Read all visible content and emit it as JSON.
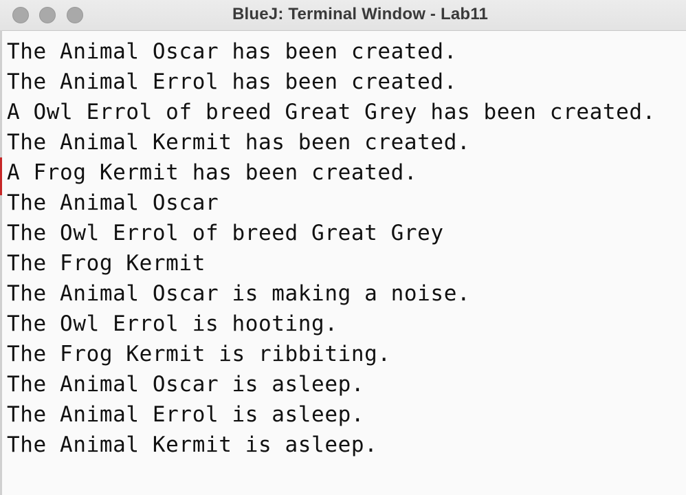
{
  "window": {
    "title": "BlueJ: Terminal Window - Lab11"
  },
  "terminal": {
    "lines": [
      "The Animal Oscar has been created.",
      "The Animal Errol has been created.",
      "A Owl Errol of breed Great Grey has been created.",
      "The Animal Kermit has been created.",
      "A Frog Kermit has been created.",
      "The Animal Oscar",
      "The Owl Errol of breed Great Grey",
      "The Frog Kermit",
      "The Animal Oscar is making a noise.",
      "The Owl Errol is hooting.",
      "The Frog Kermit is ribbiting.",
      "The Animal Oscar is asleep.",
      "The Animal Errol is asleep.",
      "The Animal Kermit is asleep."
    ]
  },
  "colors": {
    "titlebar": "#e6e6e6",
    "background": "#fafafa",
    "text": "#111111",
    "traffic_light_inactive": "#a9a9a9"
  },
  "icons": {
    "close": "close-button-circle",
    "minimize": "minimize-button-circle",
    "zoom": "zoom-button-circle"
  }
}
